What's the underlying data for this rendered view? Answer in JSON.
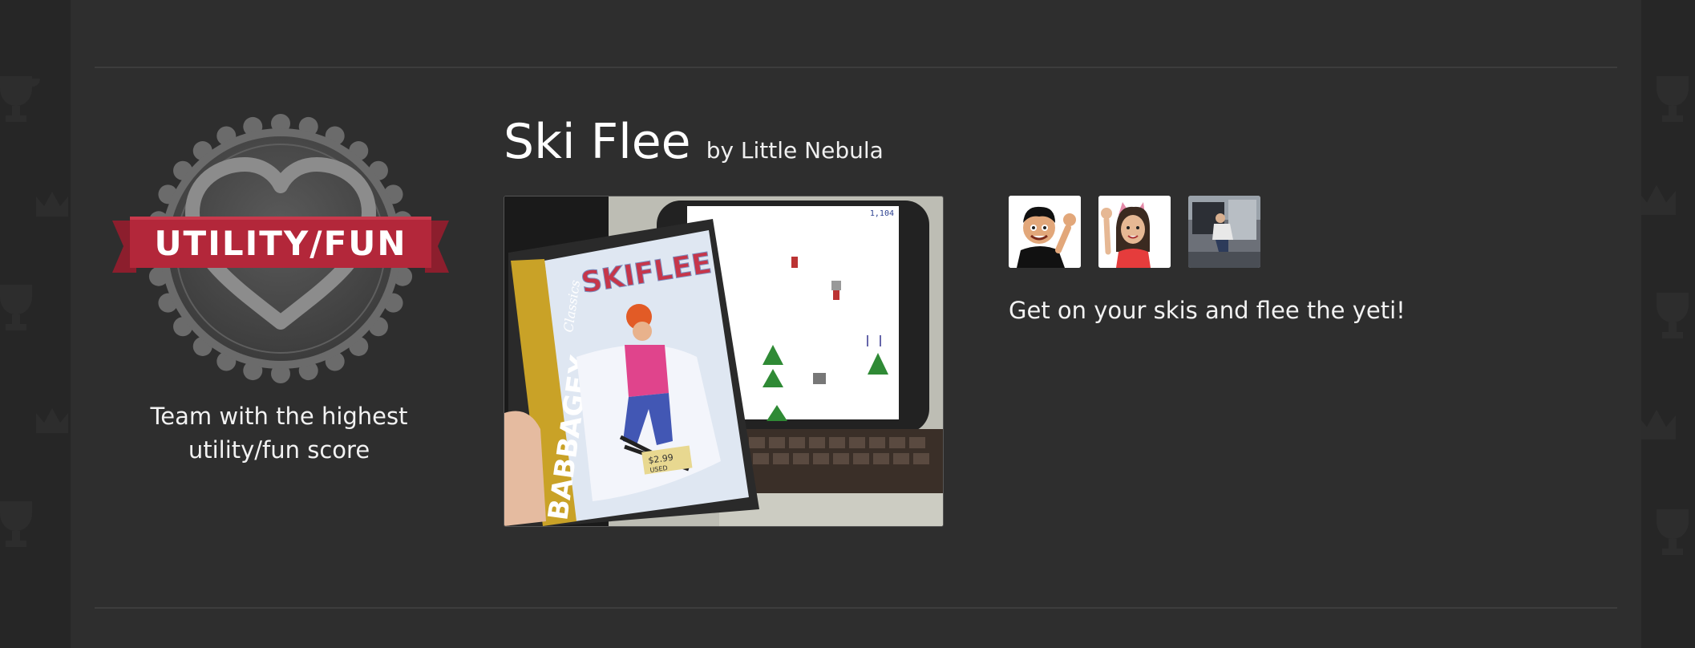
{
  "award": {
    "badge_text": "UTILITY/FUN",
    "caption": "Team with the highest utility/fun score",
    "colors": {
      "ribbon": "#b3273a",
      "badge_bg": "#4a4a4a"
    }
  },
  "game": {
    "title": "Ski Flee",
    "by_line": "by Little Nebula",
    "description": "Get on your skis and flee the yeti!",
    "screenshot": {
      "box_title": "SKIFLEE",
      "box_brand": "BABBAGEX",
      "box_series": "Classics",
      "price": "$2.99",
      "price_note": "USED",
      "score": "1,104"
    }
  },
  "team": {
    "members": [
      {
        "avatar_icon": "waving-boy-avatar-icon"
      },
      {
        "avatar_icon": "waving-girl-avatar-icon"
      },
      {
        "avatar_icon": "photo-avatar-icon"
      }
    ]
  }
}
